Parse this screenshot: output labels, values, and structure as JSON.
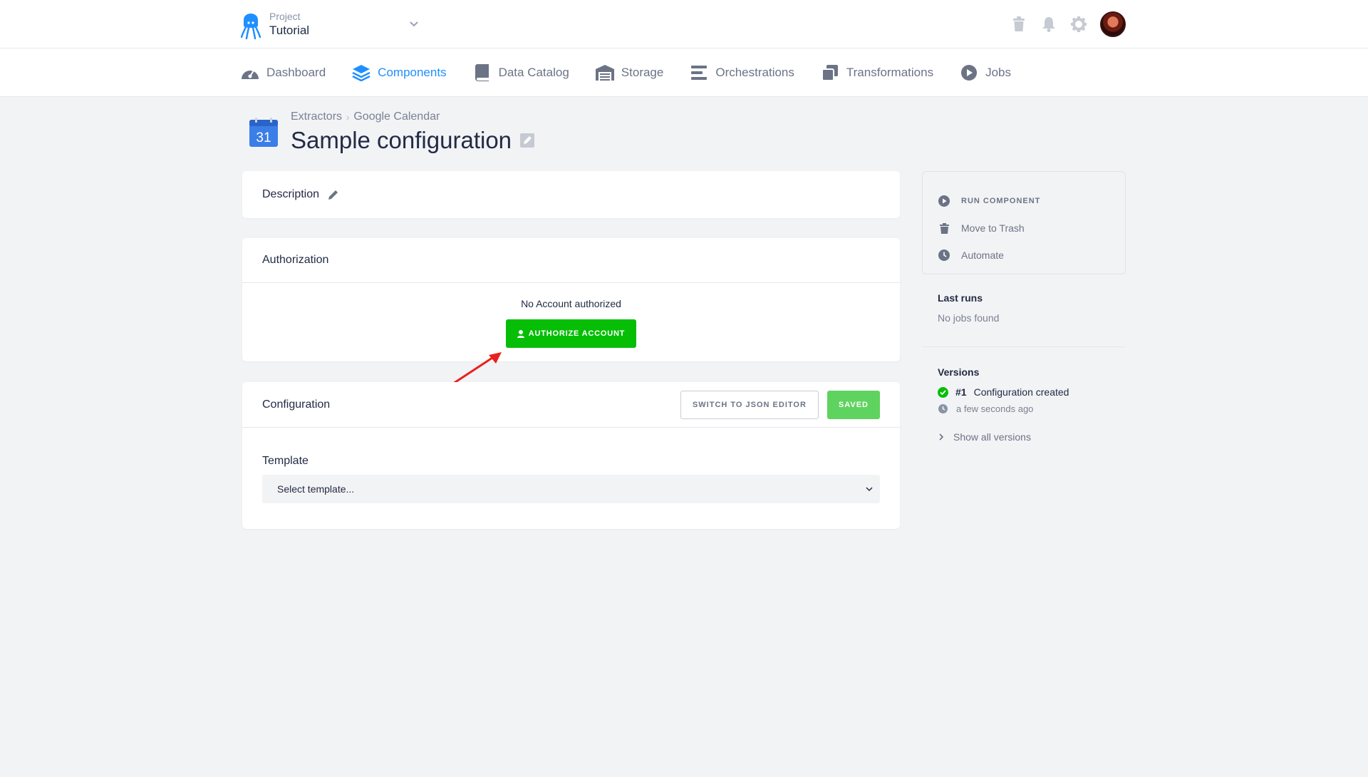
{
  "topbar": {
    "project_label": "Project",
    "project_name": "Tutorial"
  },
  "nav": {
    "items": [
      {
        "label": "Dashboard",
        "icon": "dashboard-icon"
      },
      {
        "label": "Components",
        "icon": "layers-icon",
        "active": true
      },
      {
        "label": "Data Catalog",
        "icon": "book-icon"
      },
      {
        "label": "Storage",
        "icon": "warehouse-icon"
      },
      {
        "label": "Orchestrations",
        "icon": "bars-icon"
      },
      {
        "label": "Transformations",
        "icon": "copy-icon"
      },
      {
        "label": "Jobs",
        "icon": "play-circle-icon"
      }
    ]
  },
  "header": {
    "breadcrumb": [
      "Extractors",
      "Google Calendar"
    ],
    "title": "Sample configuration",
    "calendar_day": "31"
  },
  "description": {
    "title": "Description"
  },
  "authorization": {
    "title": "Authorization",
    "status": "No Account authorized",
    "button": "AUTHORIZE ACCOUNT"
  },
  "configuration": {
    "title": "Configuration",
    "json_button": "SWITCH TO JSON EDITOR",
    "saved_button": "SAVED",
    "template_label": "Template",
    "template_placeholder": "Select template..."
  },
  "sidebar": {
    "actions": [
      {
        "label": "RUN COMPONENT",
        "icon": "play-circle-icon"
      },
      {
        "label": "Move to Trash",
        "icon": "trash-icon"
      },
      {
        "label": "Automate",
        "icon": "clock-icon"
      }
    ],
    "last_runs_title": "Last runs",
    "last_runs_empty": "No jobs found",
    "versions_title": "Versions",
    "version_number": "#1",
    "version_desc": "Configuration created",
    "version_time": "a few seconds ago",
    "show_all": "Show all versions"
  },
  "colors": {
    "accent": "#1f8fff",
    "success": "#07be07",
    "saved": "#5fd35f",
    "annotation_arrow": "#e8211e"
  }
}
